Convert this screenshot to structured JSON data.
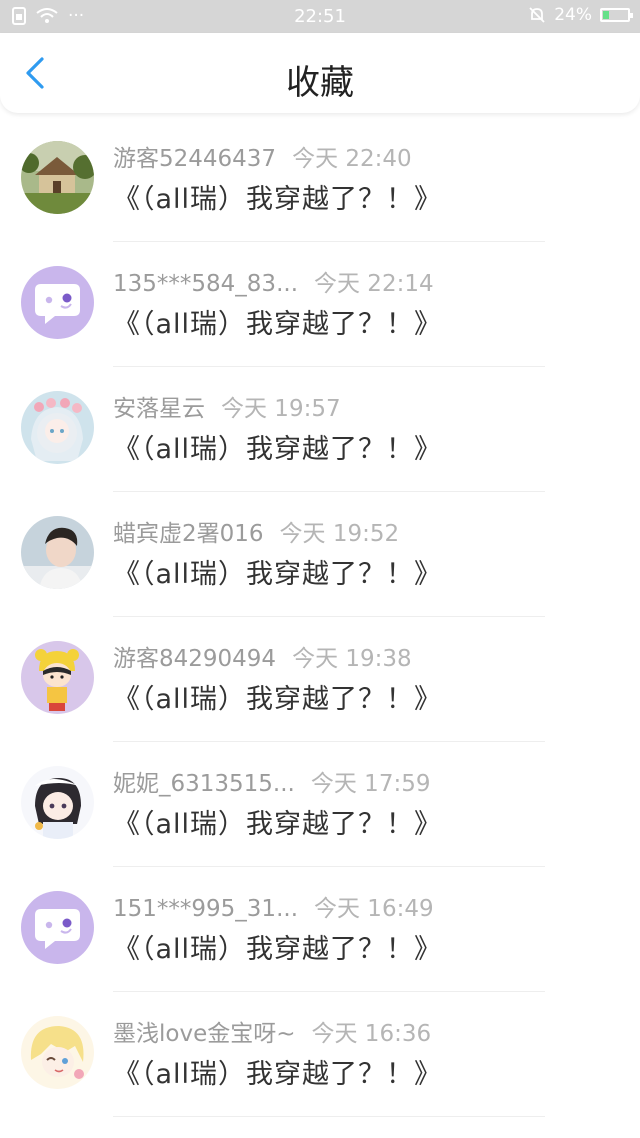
{
  "status": {
    "time": "22:51",
    "battery": "24%",
    "battery_level": 0.24,
    "dots": "···"
  },
  "header": {
    "title": "收藏"
  },
  "items": [
    {
      "user": "游客52446437",
      "time": "今天 22:40",
      "title": "《（all瑞）我穿越了？！》",
      "avatar": "landscape-avatar"
    },
    {
      "user": "135***584_83...",
      "time": "今天 22:14",
      "title": "《（all瑞）我穿越了？！》",
      "avatar": "default-chat-avatar"
    },
    {
      "user": "安落星云",
      "time": "今天 19:57",
      "title": "《（all瑞）我穿越了？！》",
      "avatar": "anime-girl-avatar"
    },
    {
      "user": "蜡宾虚2署016",
      "time": "今天 19:52",
      "title": "《（all瑞）我穿越了？！》",
      "avatar": "photo-boy-avatar"
    },
    {
      "user": "游客84290494",
      "time": "今天 19:38",
      "title": "《（all瑞）我穿越了？！》",
      "avatar": "cartoon-girl-avatar"
    },
    {
      "user": "妮妮_6313515...",
      "time": "今天 17:59",
      "title": "《（all瑞）我穿越了？！》",
      "avatar": "chibi-girl-avatar"
    },
    {
      "user": "151***995_31...",
      "time": "今天 16:49",
      "title": "《（all瑞）我穿越了？！》",
      "avatar": "default-chat-avatar"
    },
    {
      "user": "墨浅love金宝呀~",
      "time": "今天 16:36",
      "title": "《（all瑞）我穿越了？！》",
      "avatar": "blonde-anime-avatar"
    }
  ],
  "colors": {
    "accent": "#2f9bf0",
    "default_avatar": "#c9b6ec"
  }
}
